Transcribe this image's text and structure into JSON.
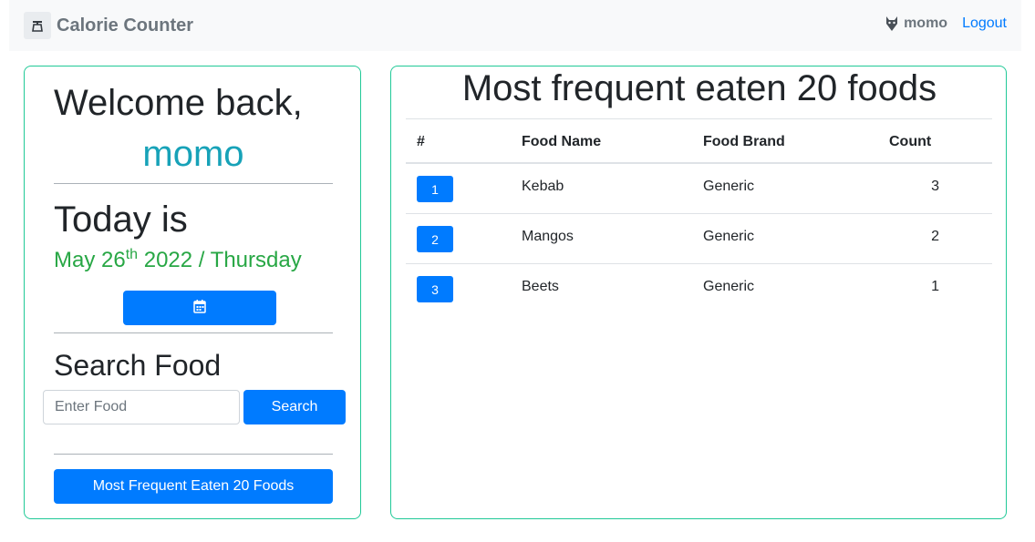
{
  "navbar": {
    "brand": "Calorie Counter",
    "brand_icon": "scale-icon",
    "user_icon": "wolf-icon",
    "username": "momo",
    "logout": "Logout"
  },
  "sidebar": {
    "welcome": "Welcome back,",
    "name": "momo",
    "today_label": "Today is",
    "date_month_day": "May 26",
    "date_suffix": "th",
    "date_rest": " 2022 / Thursday",
    "calendar_icon": "calendar-icon",
    "search_title": "Search Food",
    "search_placeholder": "Enter Food",
    "search_button": "Search",
    "frequent_button": "Most Frequent Eaten 20 Foods"
  },
  "main": {
    "title": "Most frequent eaten 20 foods",
    "columns": [
      "#",
      "Food Name",
      "Food Brand",
      "Count"
    ],
    "rows": [
      {
        "rank": "1",
        "name": "Kebab",
        "brand": "Generic",
        "count": "3"
      },
      {
        "rank": "2",
        "name": "Mangos",
        "brand": "Generic",
        "count": "2"
      },
      {
        "rank": "3",
        "name": "Beets",
        "brand": "Generic",
        "count": "1"
      }
    ]
  },
  "colors": {
    "primary": "#007bff",
    "card_border": "#20c997",
    "name": "#17a2b8",
    "date": "#28a745"
  }
}
